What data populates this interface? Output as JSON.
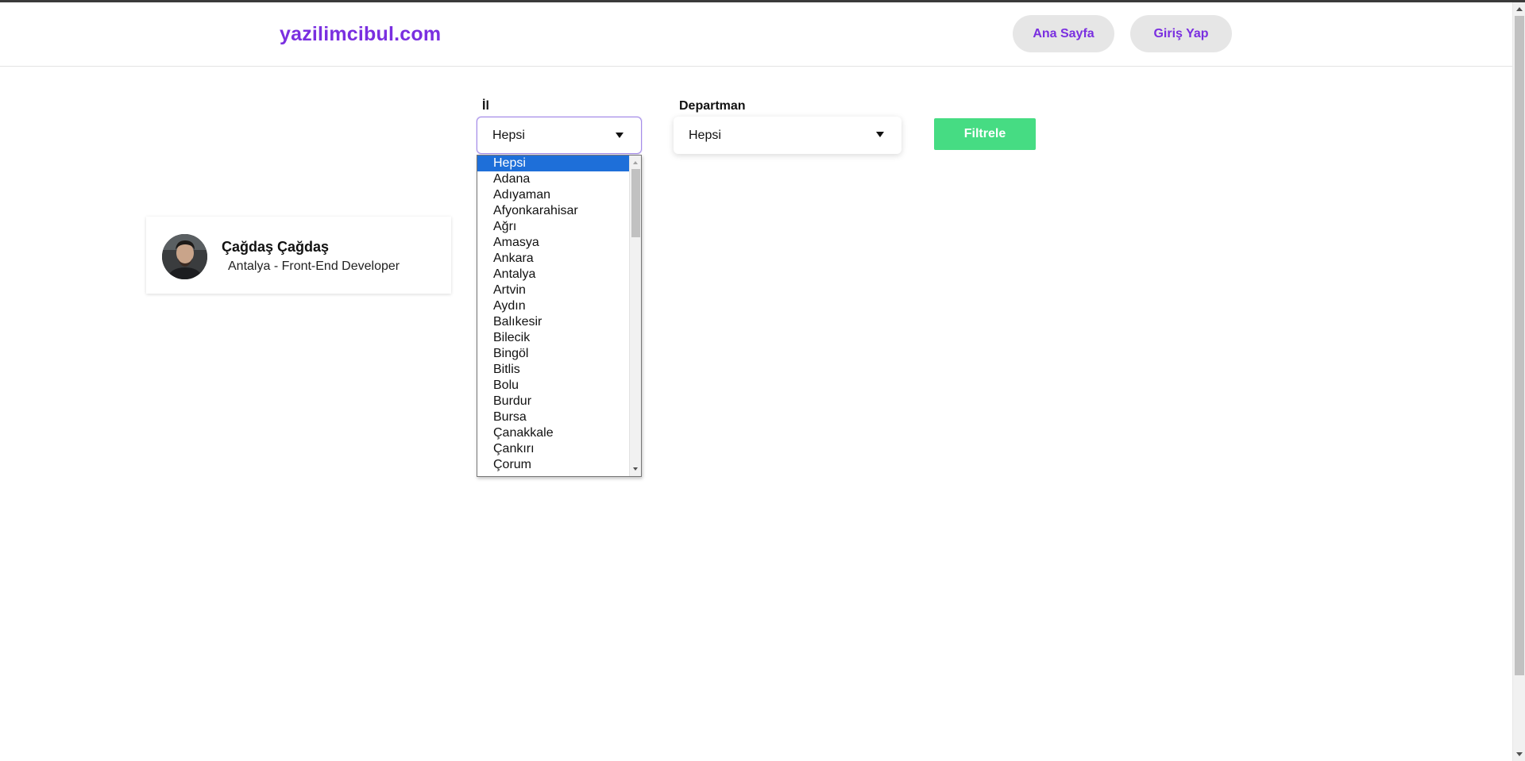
{
  "header": {
    "brand": "yazilimcibul.com",
    "nav": {
      "home_label": "Ana Sayfa",
      "login_label": "Giriş Yap"
    }
  },
  "filters": {
    "il": {
      "label": "İl",
      "selected": "Hepsi",
      "options": [
        "Hepsi",
        "Adana",
        "Adıyaman",
        "Afyonkarahisar",
        "Ağrı",
        "Amasya",
        "Ankara",
        "Antalya",
        "Artvin",
        "Aydın",
        "Balıkesir",
        "Bilecik",
        "Bingöl",
        "Bitlis",
        "Bolu",
        "Burdur",
        "Bursa",
        "Çanakkale",
        "Çankırı",
        "Çorum"
      ]
    },
    "departman": {
      "label": "Departman",
      "selected": "Hepsi"
    },
    "submit_label": "Filtrele"
  },
  "profiles": [
    {
      "name": "Çağdaş Çağdaş",
      "subtitle": "Antalya - Front-End Developer"
    }
  ],
  "colors": {
    "brand": "#7a2fe0",
    "filter_button": "#46dc83",
    "selected_option": "#1e6fd9",
    "nav_button_bg": "#e6e6e6"
  },
  "icons": {
    "select_caret": "caret-down-icon",
    "avatar": "user-photo"
  }
}
